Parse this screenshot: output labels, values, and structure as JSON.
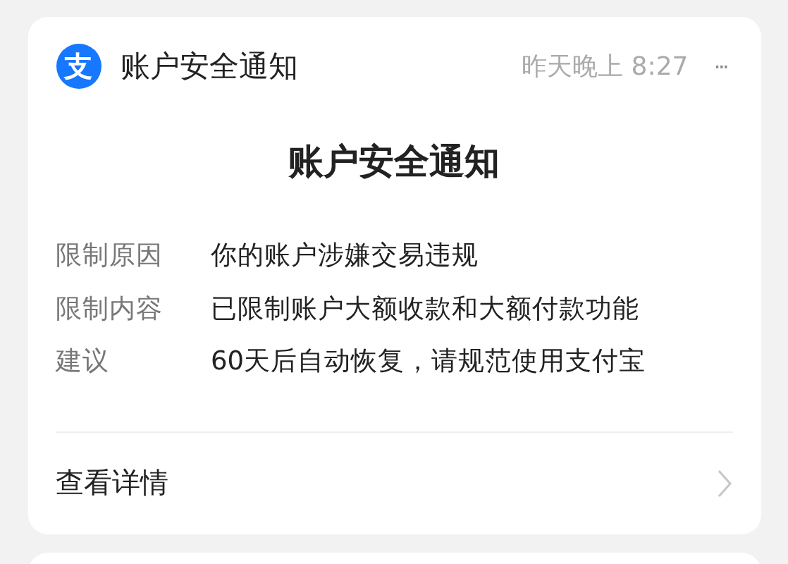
{
  "notification": {
    "app_icon_glyph": "支",
    "title": "账户安全通知",
    "time": "昨天晚上 8:27",
    "more": "···",
    "heading": "账户安全通知",
    "fields": [
      {
        "label": "限制原因",
        "value": "你的账户涉嫌交易违规"
      },
      {
        "label": "限制内容",
        "value": "已限制账户大额收款和大额付款功能"
      },
      {
        "label": "建议",
        "value": "60天后自动恢复，请规范使用支付宝"
      }
    ],
    "link": "查看详情"
  }
}
